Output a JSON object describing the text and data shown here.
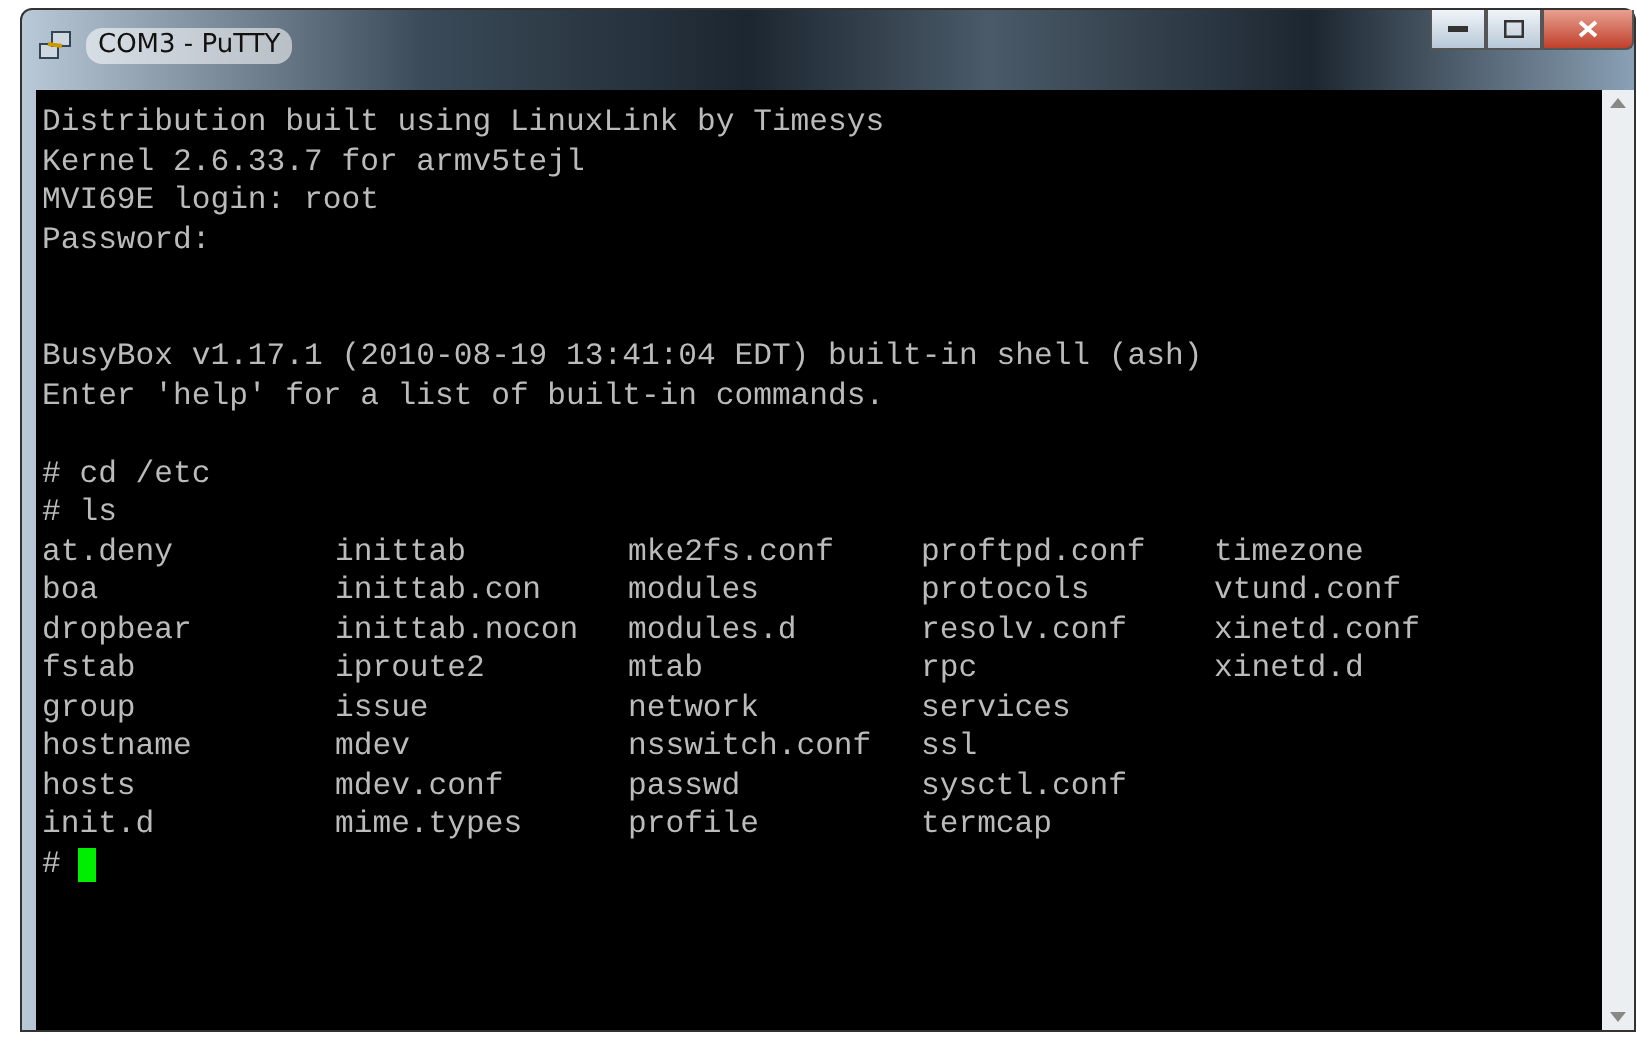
{
  "window": {
    "title": "COM3 - PuTTY"
  },
  "terminal": {
    "blocks": [
      {
        "lines": [
          "Distribution built using LinuxLink by Timesys",
          "Kernel 2.6.33.7 for armv5tejl",
          "MVI69E login: root",
          "Password:"
        ]
      },
      {
        "lines": [
          "BusyBox v1.17.1 (2010-08-19 13:41:04 EDT) built-in shell (ash)",
          "Enter 'help' for a list of built-in commands."
        ]
      },
      {
        "lines": [
          "# cd /etc",
          "# ls"
        ]
      }
    ],
    "listing": [
      [
        "at.deny",
        "inittab",
        "mke2fs.conf",
        "proftpd.conf",
        "timezone"
      ],
      [
        "boa",
        "inittab.con",
        "modules",
        "protocols",
        "vtund.conf"
      ],
      [
        "dropbear",
        "inittab.nocon",
        "modules.d",
        "resolv.conf",
        "xinetd.conf"
      ],
      [
        "fstab",
        "iproute2",
        "mtab",
        "rpc",
        "xinetd.d"
      ],
      [
        "group",
        "issue",
        "network",
        "services"
      ],
      [
        "hostname",
        "mdev",
        "nsswitch.conf",
        "ssl"
      ],
      [
        "hosts",
        "mdev.conf",
        "passwd",
        "sysctl.conf"
      ],
      [
        "init.d",
        "mime.types",
        "profile",
        "termcap"
      ]
    ],
    "prompt": "#"
  }
}
